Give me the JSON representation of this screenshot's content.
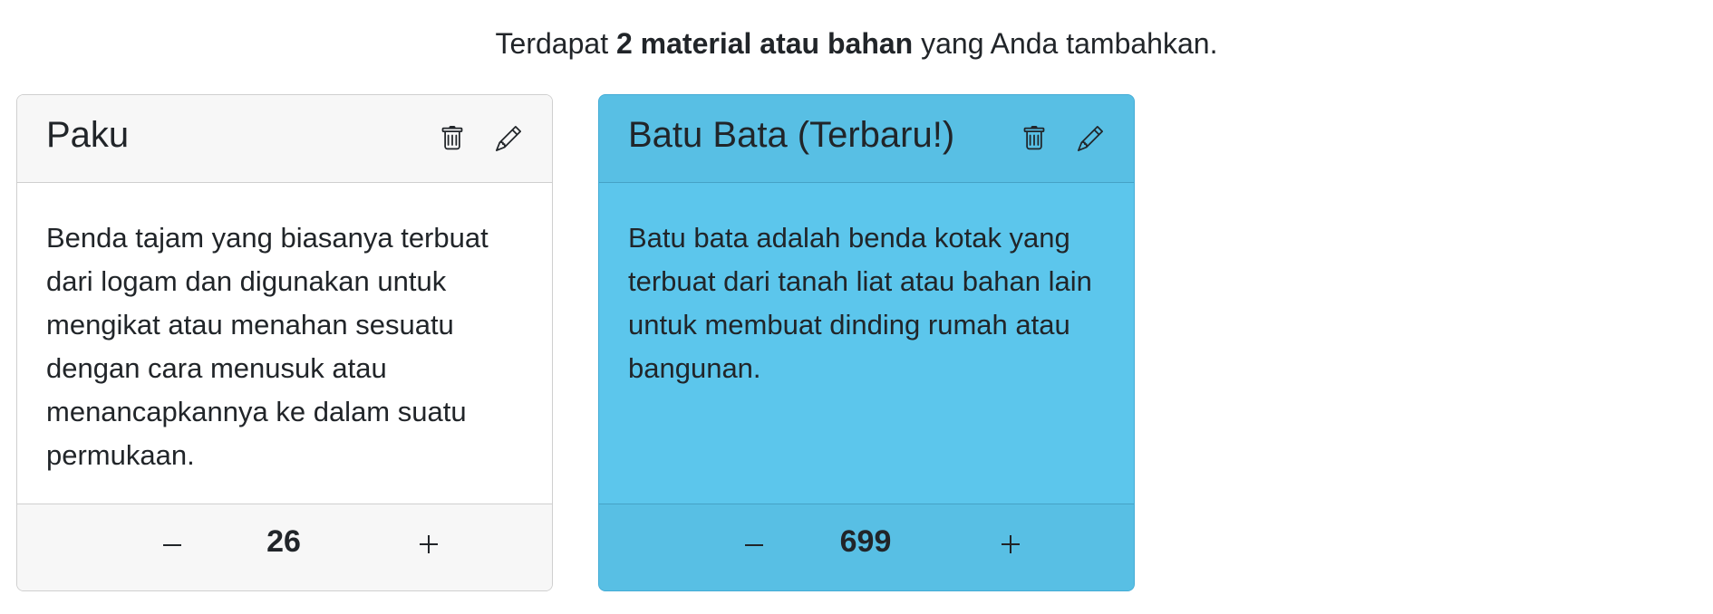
{
  "summary": {
    "prefix": "Terdapat",
    "highlight": "2 material atau bahan",
    "suffix": "yang Anda tambahkan."
  },
  "materials": [
    {
      "title": "Paku",
      "description": "Benda tajam yang biasanya terbuat dari logam dan digunakan untuk mengikat atau menahan sesuatu dengan cara menusuk atau menancapkannya ke dalam suatu permukaan.",
      "quantity": "26",
      "delete_icon": "trash-icon",
      "edit_icon": "pencil-icon",
      "style": "light"
    },
    {
      "title": "Batu Bata (Terbaru!)",
      "description": "Batu bata adalah benda kotak yang terbuat dari tanah liat atau bahan lain untuk membuat dinding rumah atau bangunan.",
      "quantity": "699",
      "delete_icon": "trash-icon",
      "edit_icon": "pencil-icon",
      "style": "highlighted",
      "highlight_color": "#5cc6ec"
    }
  ],
  "icons": {
    "decrement": "minus-icon",
    "increment": "plus-icon"
  }
}
